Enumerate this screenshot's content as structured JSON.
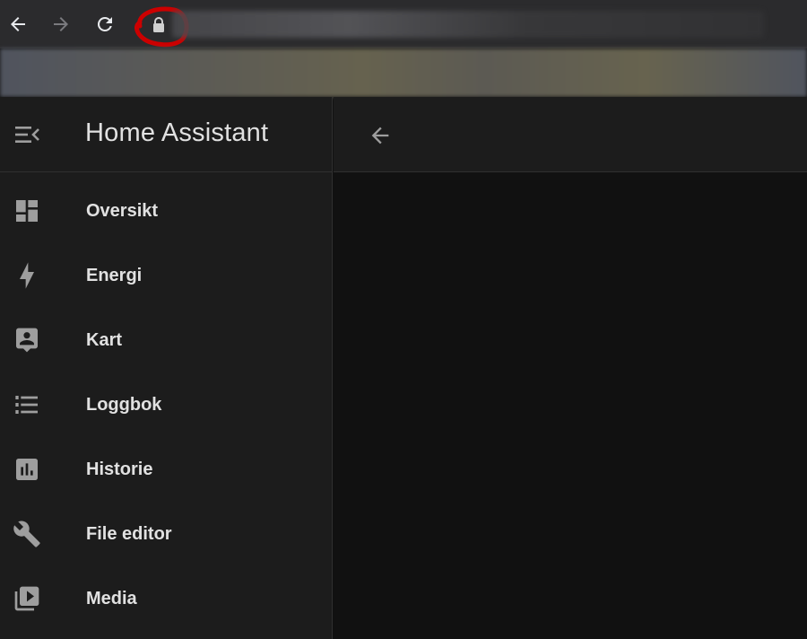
{
  "browser": {
    "back_icon": "arrow-left-icon",
    "forward_icon": "arrow-right-icon",
    "reload_icon": "reload-icon",
    "lock_icon": "lock-icon",
    "highlight_color": "#cc0000"
  },
  "sidebar": {
    "title": "Home Assistant",
    "menu_icon": "menu-collapse-icon",
    "items": [
      {
        "label": "Oversikt",
        "icon": "dashboard-icon"
      },
      {
        "label": "Energi",
        "icon": "lightning-bolt-icon"
      },
      {
        "label": "Kart",
        "icon": "map-person-icon"
      },
      {
        "label": "Loggbok",
        "icon": "list-icon"
      },
      {
        "label": "Historie",
        "icon": "bar-chart-icon"
      },
      {
        "label": "File editor",
        "icon": "wrench-icon"
      },
      {
        "label": "Media",
        "icon": "play-box-multiple-icon"
      }
    ]
  },
  "main": {
    "back_icon": "arrow-left-icon"
  },
  "colors": {
    "sidebar_bg": "#1c1c1c",
    "main_bg": "#111111",
    "icon": "#9e9e9e",
    "text": "#e1e1e1"
  }
}
